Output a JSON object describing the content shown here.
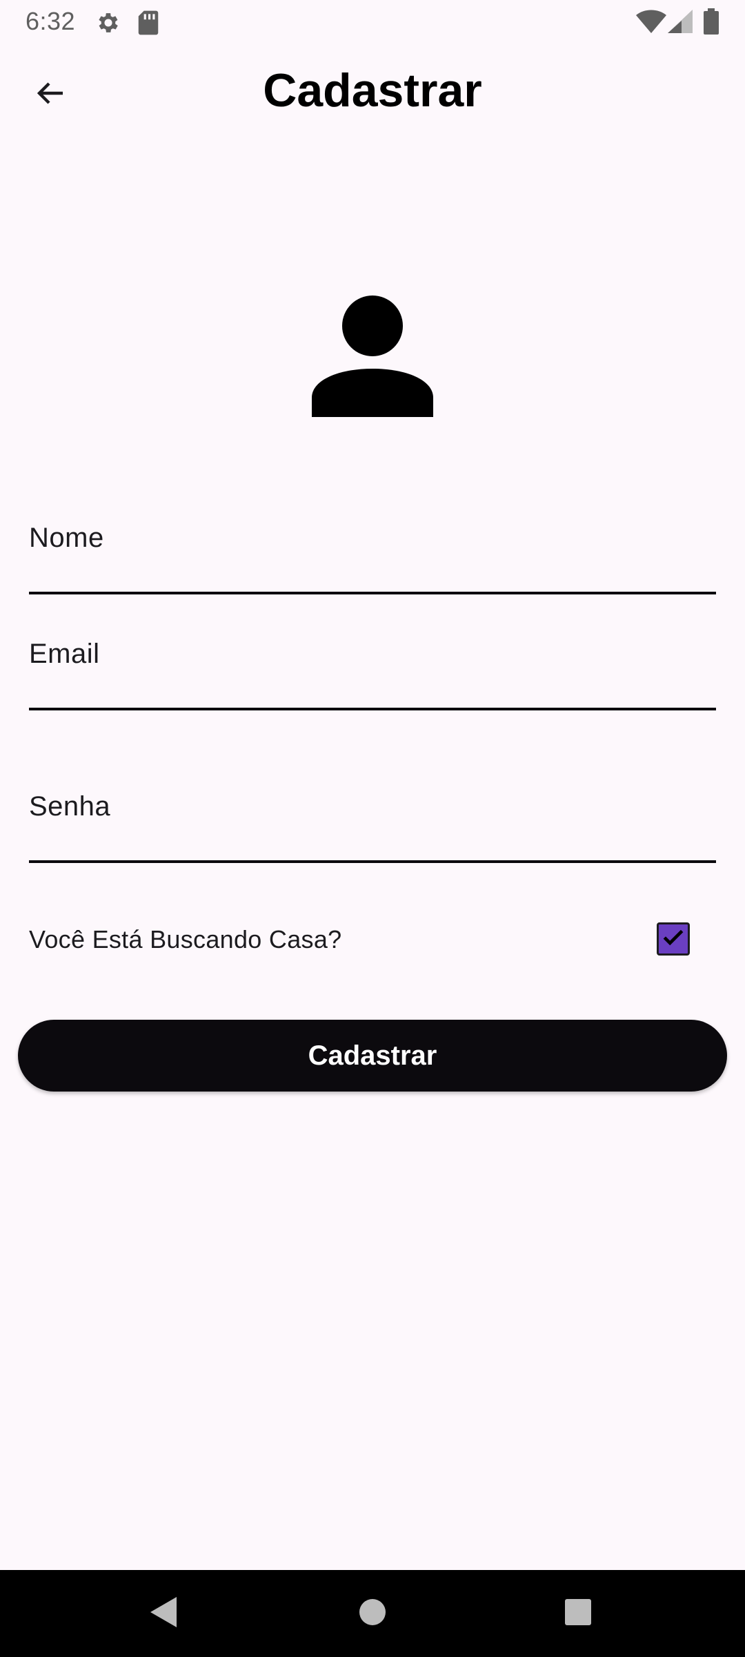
{
  "status_bar": {
    "time": "6:32",
    "icons": [
      "settings-icon",
      "sd-card-icon",
      "wifi-icon",
      "signal-icon",
      "battery-icon"
    ]
  },
  "app_bar": {
    "title": "Cadastrar",
    "back_icon": "arrow-back-icon"
  },
  "avatar": {
    "icon": "person-icon"
  },
  "form": {
    "name_label": "Nome",
    "email_label": "Email",
    "password_label": "Senha",
    "checkbox_label": "Você Está Buscando Casa?",
    "checkbox_checked": true,
    "submit_label": "Cadastrar"
  },
  "colors": {
    "background": "#fdf8fc",
    "checkbox_fill": "#6a3fc1",
    "button": "#0c0a0e"
  },
  "nav_bar": {
    "icons": [
      "back-triangle-icon",
      "home-circle-icon",
      "recents-square-icon"
    ]
  }
}
